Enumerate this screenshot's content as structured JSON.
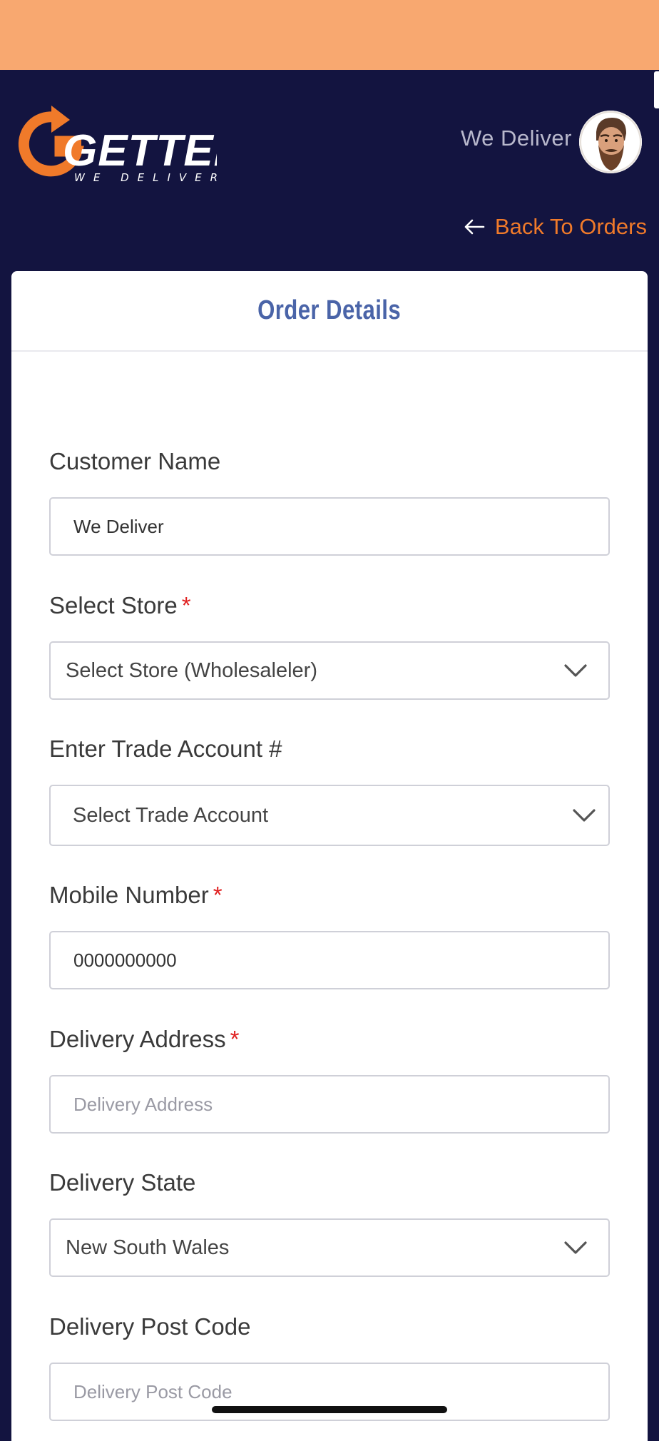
{
  "header": {
    "logo_text": "GETTER",
    "logo_tagline": "WE DELIVER",
    "user_name": "We Deliver",
    "back_label": "Back To Orders"
  },
  "card": {
    "title": "Order Details"
  },
  "form": {
    "customer_name": {
      "label": "Customer Name",
      "value": "We Deliver"
    },
    "store": {
      "label": "Select Store",
      "required_mark": "*",
      "selected": "Select Store (Wholesaleler)"
    },
    "trade_account": {
      "label": "Enter Trade Account #",
      "selected": "Select Trade Account"
    },
    "mobile": {
      "label": "Mobile Number",
      "required_mark": "*",
      "value": "0000000000"
    },
    "address": {
      "label": "Delivery Address",
      "required_mark": "*",
      "placeholder": "Delivery Address"
    },
    "state": {
      "label": "Delivery State",
      "selected": "New South Wales"
    },
    "postcode": {
      "label": "Delivery Post Code",
      "placeholder": "Delivery Post Code"
    }
  },
  "colors": {
    "status_bar": "#f8a870",
    "header_bg": "#131440",
    "accent_orange": "#f07a2a",
    "title_blue": "#4a64a8",
    "required_red": "#e02020"
  },
  "icons": [
    "getter-logo-icon",
    "avatar-icon",
    "arrow-left-icon",
    "chevron-down-icon"
  ]
}
